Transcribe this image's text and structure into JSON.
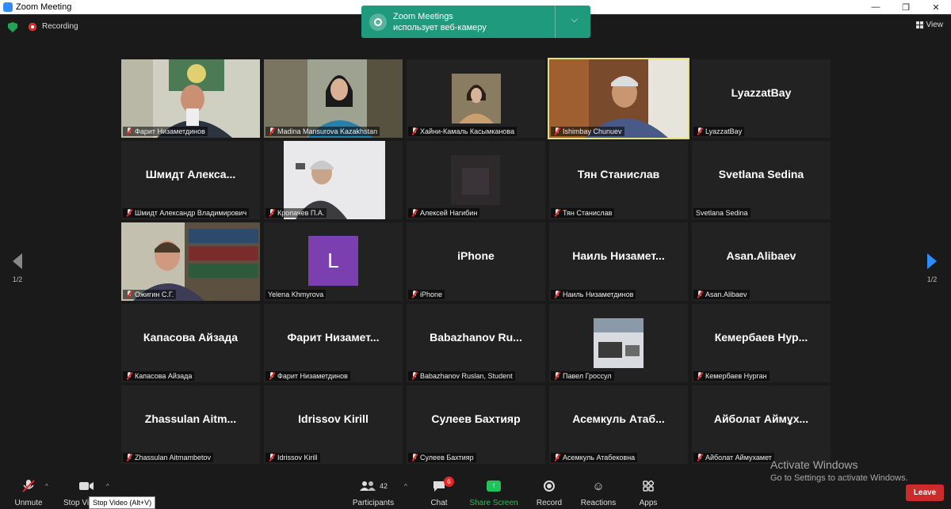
{
  "window": {
    "title": "Zoom Meeting",
    "controls": [
      "—",
      "❐",
      "✕"
    ]
  },
  "topbar": {
    "recording_label": "Recording",
    "view_label": "View"
  },
  "notification": {
    "line1": "Zoom Meetings",
    "line2": "использует веб-камеру",
    "chevron": "⌵"
  },
  "pagination": {
    "left": "1/2",
    "right": "1/2"
  },
  "tiles": [
    {
      "label": "Фарит Низаметдинов",
      "big": "",
      "video": "v1"
    },
    {
      "label": "Madina Mansurova Kazakhstan",
      "big": "",
      "video": "v2"
    },
    {
      "label": "Хайни-Камаль Касымканова",
      "big": "",
      "video": "v3"
    },
    {
      "label": "Ishimbay Chunuev",
      "big": "",
      "video": "v4",
      "active": true
    },
    {
      "label": "LyazzatBay",
      "big": "LyazzatBay"
    },
    {
      "label": "Шмидт Александр Владимирович",
      "big": "Шмидт  Алекса..."
    },
    {
      "label": "Кропачев П.А.",
      "big": "",
      "video": "v5"
    },
    {
      "label": "Алексей Нагибин",
      "big": "",
      "video": "v6"
    },
    {
      "label": "Тян Станислав",
      "big": "Тян Станислав"
    },
    {
      "label": "Svetlana Sedina",
      "big": "Svetlana Sedina",
      "unmuted": true
    },
    {
      "label": "Ожигин С.Г.",
      "big": "",
      "video": "v7"
    },
    {
      "label": "Yelena Khmyrova",
      "big": "",
      "avatar": "L",
      "unmuted": true
    },
    {
      "label": "iPhone",
      "big": "iPhone"
    },
    {
      "label": "Наиль Низаметдинов",
      "big": "Наиль  Низамет..."
    },
    {
      "label": "Asan.Alibaev",
      "big": "Asan.Alibaev"
    },
    {
      "label": "Капасова Айзада",
      "big": "Капасова Айзада"
    },
    {
      "label": "Фарит Низаметдинов",
      "big": "Фарит  Низамет..."
    },
    {
      "label": "Babazhanov Ruslan, Student",
      "big": "Babazhanov  Ru..."
    },
    {
      "label": "Павел Гроссул",
      "big": "",
      "video": "v8"
    },
    {
      "label": "Кемербаев Нурган",
      "big": "Кемербаев  Нур..."
    },
    {
      "label": "Zhassulan Aitmambetov",
      "big": "Zhassulan  Aitm..."
    },
    {
      "label": "Idrissov Kirill",
      "big": "Idrissov Kirill"
    },
    {
      "label": "Сулеев Бахтияр",
      "big": "Сулеев Бахтияр"
    },
    {
      "label": "Асемкуль Атабековна",
      "big": "Асемкуль  Атаб..."
    },
    {
      "label": "Айболат Аймухамет",
      "big": "Айболат  Аймұх..."
    }
  ],
  "toolbar": {
    "unmute": "Unmute",
    "stop_video": "Stop Video",
    "participants": "Participants",
    "participants_count": "42",
    "chat": "Chat",
    "chat_badge": "6",
    "share": "Share Screen",
    "record": "Record",
    "reactions": "Reactions",
    "apps": "Apps",
    "leave": "Leave"
  },
  "tooltip": "Stop Video (Alt+V)",
  "activation": {
    "line1": "Activate Windows",
    "line2": "Go to Settings to activate Windows."
  },
  "colors": {
    "share": "#23c15b",
    "leave": "#cc2b2b",
    "notice": "#1f9a7c",
    "active_speaker": "#e6e07a"
  }
}
